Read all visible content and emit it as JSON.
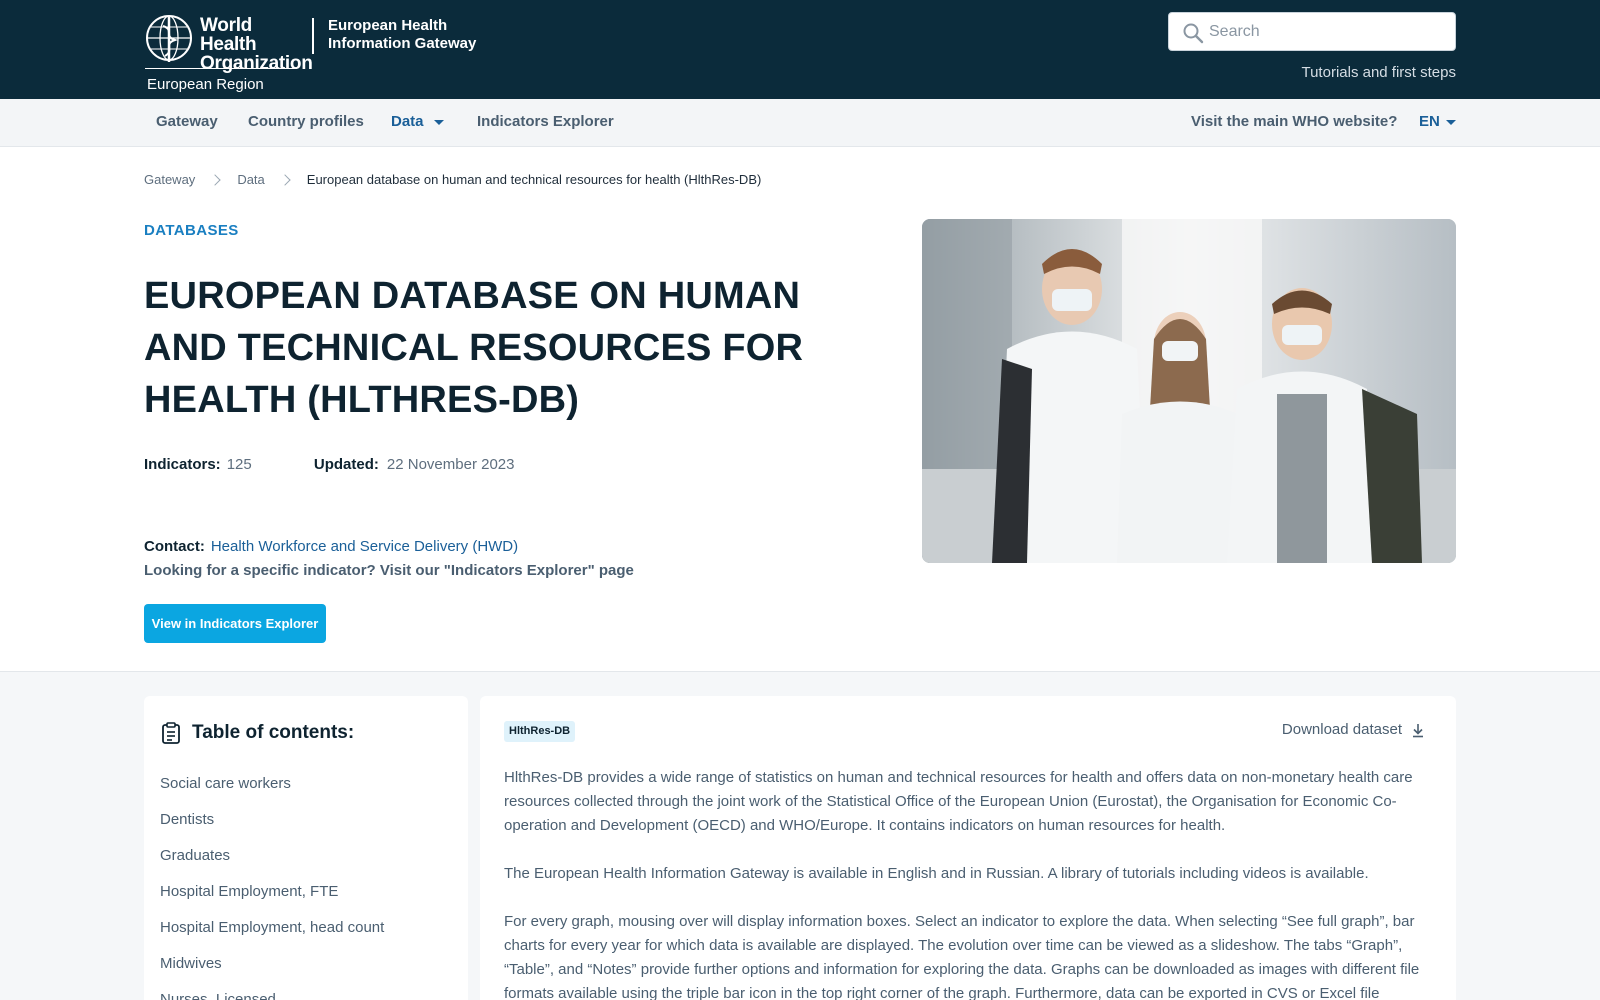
{
  "header": {
    "logo": {
      "org_line1": "World Health",
      "org_line2": "Organization",
      "region": "European Region"
    },
    "brand_line1": "European Health",
    "brand_line2": "Information Gateway",
    "search": {
      "placeholder": "Search",
      "value": ""
    },
    "tutorials_link": "Tutorials and first steps"
  },
  "nav": {
    "items": [
      {
        "label": "Gateway"
      },
      {
        "label": "Country profiles"
      },
      {
        "label": "Data"
      },
      {
        "label": "Indicators Explorer"
      }
    ],
    "visit_main": "Visit the main WHO website?",
    "language": "EN"
  },
  "breadcrumb": {
    "items": [
      "Gateway",
      "Data"
    ],
    "current": "European database on human and technical resources for health (HlthRes-DB)"
  },
  "hero": {
    "kicker": "DATABASES",
    "title": "EUROPEAN DATABASE ON HUMAN AND TECHNICAL RESOURCES FOR HEALTH (HLTHRES-DB)",
    "indicators_label": "Indicators:",
    "indicators_value": "125",
    "updated_label": "Updated:",
    "updated_value": "22 November 2023",
    "contact_label": "Contact:",
    "contact_link": "Health Workforce and Service Delivery (HWD)",
    "looking_text": "Looking for a specific indicator? Visit our \"Indicators Explorer\" page",
    "cta_button": "View in Indicators Explorer"
  },
  "toc": {
    "title": "Table of contents:",
    "items": [
      "Social care workers",
      "Dentists",
      "Graduates",
      "Hospital Employment, FTE",
      "Hospital Employment, head count",
      "Midwives",
      "Nurses, Licensed"
    ]
  },
  "content": {
    "tag": "HlthRes-DB",
    "download": "Download dataset",
    "paragraphs": [
      "HlthRes-DB provides a wide range of statistics on human and technical resources for health and offers data on non-monetary health care resources collected through the joint work of the Statistical Office of the European Union (Eurostat), the Organisation for Economic Co-operation and Development (OECD) and WHO/Europe. It contains indicators on human resources for health.",
      "The European Health Information Gateway is available in English and in Russian. A library of tutorials including videos is available.",
      " For every graph, mousing over will display information boxes. Select an indicator to explore the data. When selecting “See full graph”, bar charts for every year for which data is available are displayed. The evolution over time can be viewed as a slideshow. The tabs “Graph”, “Table”, and “Notes” provide further options and information for exploring the data. Graphs can be downloaded as images with different file formats available using the triple bar icon in the top right corner of the graph. Furthermore, data can be exported in CVS or Excel file"
    ]
  },
  "colors": {
    "header_bg": "#0b2b3b",
    "accent": "#1a5f98",
    "cta": "#0ba6e1",
    "kicker": "#1a7fc1"
  }
}
